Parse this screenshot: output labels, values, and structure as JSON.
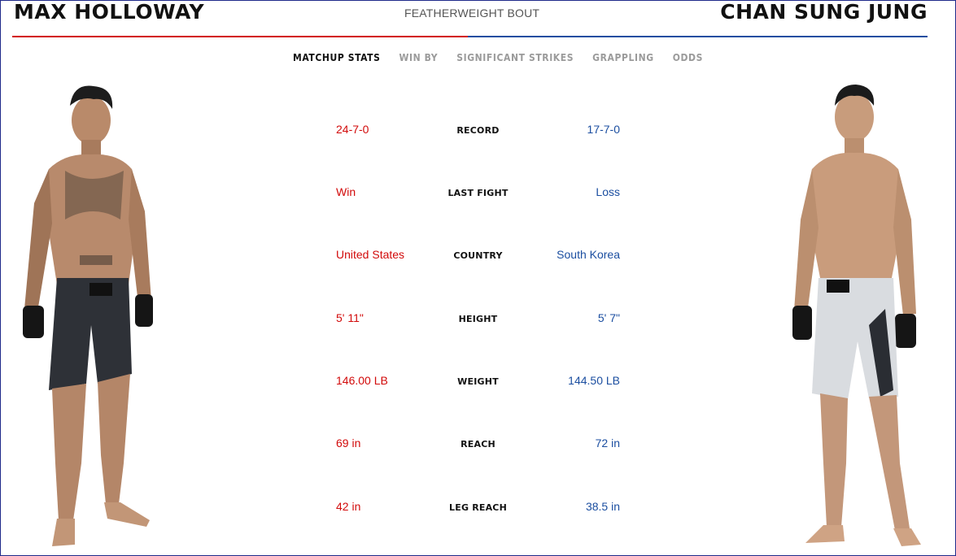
{
  "header": {
    "left_fighter": "MAX HOLLOWAY",
    "bout_type": "FEATHERWEIGHT BOUT",
    "right_fighter": "CHAN SUNG JUNG"
  },
  "colors": {
    "red_corner": "#d20a0a",
    "blue_corner": "#1b4ea0"
  },
  "tabs": [
    {
      "label": "MATCHUP STATS",
      "active": true
    },
    {
      "label": "WIN BY",
      "active": false
    },
    {
      "label": "SIGNIFICANT STRIKES",
      "active": false
    },
    {
      "label": "GRAPPLING",
      "active": false
    },
    {
      "label": "ODDS",
      "active": false
    }
  ],
  "stats": [
    {
      "label": "RECORD",
      "left": "24-7-0",
      "right": "17-7-0"
    },
    {
      "label": "LAST FIGHT",
      "left": "Win",
      "right": "Loss"
    },
    {
      "label": "COUNTRY",
      "left": "United States",
      "right": "South Korea"
    },
    {
      "label": "HEIGHT",
      "left": "5' 11\"",
      "right": "5' 7\""
    },
    {
      "label": "WEIGHT",
      "left": "146.00 LB",
      "right": "144.50 LB"
    },
    {
      "label": "REACH",
      "left": "69 in",
      "right": "72 in"
    },
    {
      "label": "LEG REACH",
      "left": "42 in",
      "right": "38.5 in"
    }
  ]
}
